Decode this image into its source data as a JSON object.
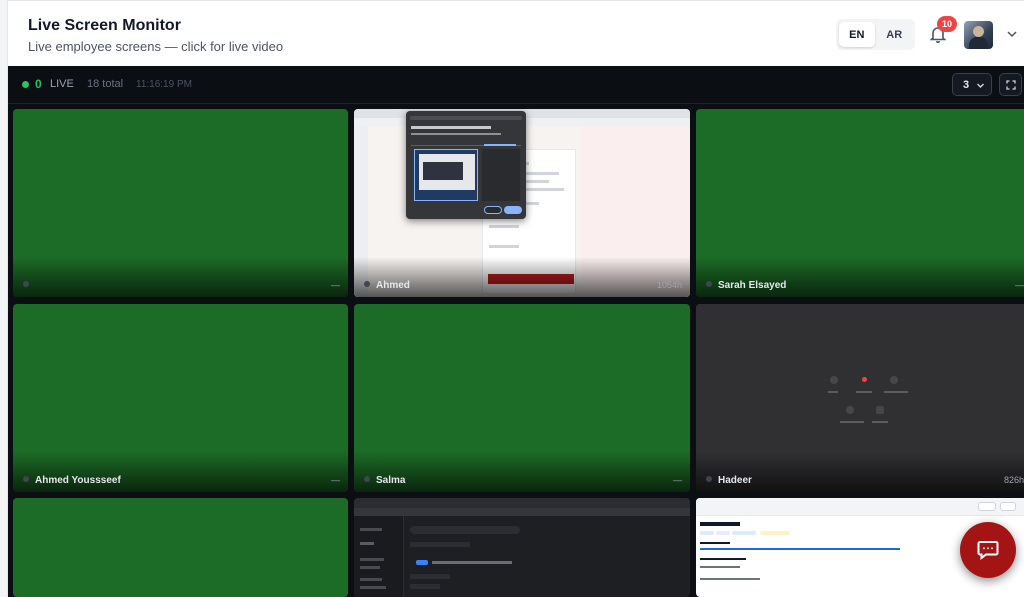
{
  "header": {
    "title": "Live Screen Monitor",
    "subtitle": "Live employee screens — click for live video",
    "languages": [
      "EN",
      "AR"
    ],
    "active_language": "EN",
    "notification_count": "10"
  },
  "toolbar": {
    "live_count": "0",
    "live_label": "LIVE",
    "total_label": "18 total",
    "clock": "11:16:19 PM",
    "columns_value": "3"
  },
  "tiles": [
    {
      "name": "",
      "duration": "—",
      "preview": "green"
    },
    {
      "name": "Ahmed",
      "duration": "1054h",
      "preview": "browser-share-dialog"
    },
    {
      "name": "Sarah Elsayed",
      "duration": "—",
      "preview": "green"
    },
    {
      "name": "Ahmed Youssseef",
      "duration": "—",
      "preview": "green"
    },
    {
      "name": "Salma",
      "duration": "—",
      "preview": "green"
    },
    {
      "name": "Hadeer",
      "duration": "826h",
      "preview": "dark-app"
    },
    {
      "name": "",
      "duration": "",
      "preview": "green"
    },
    {
      "name": "",
      "duration": "",
      "preview": "dark-browser"
    },
    {
      "name": "",
      "duration": "",
      "preview": "document"
    }
  ],
  "icons": {
    "notification": "bell-icon",
    "profile_menu": "chevron-down-icon",
    "columns": "chevron-down-icon",
    "fullscreen": "fullscreen-icon",
    "chat": "chat-icon"
  },
  "colors": {
    "live": "#22c55e",
    "badge": "#ef4444",
    "offline_tile": "#1c6b26",
    "chat_button": "#a51414"
  }
}
